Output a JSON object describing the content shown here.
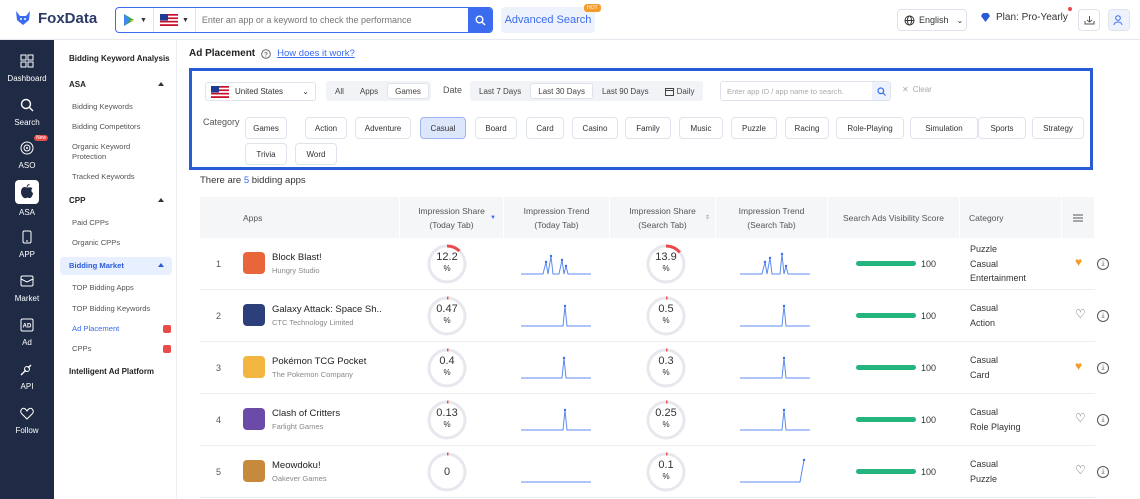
{
  "header": {
    "logo": "FoxData",
    "search_placeholder": "Enter an app or a keyword to check the performance",
    "advanced_search": "Advanced Search",
    "hot_badge": "HOT",
    "language": "English",
    "plan": "Plan: Pro-Yearly"
  },
  "sidebar": {
    "items": [
      {
        "label": "Dashboard",
        "icon": "grid-icon"
      },
      {
        "label": "Search",
        "icon": "search-icon"
      },
      {
        "label": "ASO",
        "icon": "target-icon",
        "badge": "New"
      },
      {
        "label": "ASA",
        "icon": "apple-icon"
      },
      {
        "label": "APP",
        "icon": "phone-icon"
      },
      {
        "label": "Market",
        "icon": "market-icon"
      },
      {
        "label": "Ad",
        "icon": "ad-icon"
      },
      {
        "label": "API",
        "icon": "api-icon"
      },
      {
        "label": "Follow",
        "icon": "heart-icon"
      }
    ]
  },
  "subnav": {
    "title": "Bidding Keyword Analysis",
    "asa": "ASA",
    "asa_items": [
      "Bidding Keywords",
      "Bidding Competitors",
      "Organic Keyword Protection",
      "Tracked Keywords"
    ],
    "cpp": "CPP",
    "cpp_items": [
      "Paid CPPs",
      "Organic CPPs"
    ],
    "bidding_market": "Bidding Market",
    "market_items": [
      "TOP Bidding Apps",
      "TOP Bidding Keywords",
      "Ad Placement",
      "CPPs"
    ],
    "intelligent": "Intelligent Ad Platform"
  },
  "page": {
    "title": "Ad Placement",
    "help_link": "How does it work?",
    "count_prefix": "There are ",
    "count": "5",
    "count_suffix": " bidding apps"
  },
  "filters": {
    "country": "United States",
    "type_tabs": [
      "All",
      "Apps",
      "Games"
    ],
    "type_selected": "Games",
    "date_label": "Date",
    "date_tabs": [
      "Last 7 Days",
      "Last 30 Days",
      "Last 90 Days",
      "Daily"
    ],
    "date_selected": "Last 30 Days",
    "app_search_placeholder": "Enter app ID / app name to search.",
    "clear": "Clear",
    "category_label": "Category",
    "categories": [
      "Games",
      "Action",
      "Adventure",
      "Casual",
      "Board",
      "Card",
      "Casino",
      "Family",
      "Music",
      "Puzzle",
      "Racing",
      "Role-Playing",
      "Simulation",
      "Sports",
      "Strategy",
      "Trivia",
      "Word"
    ],
    "category_selected": "Casual"
  },
  "table": {
    "headers": [
      "Apps",
      "Impression Share (Today Tab)",
      "Impression Trend (Today Tab)",
      "Impression Share (Search Tab)",
      "Impression Trend (Search Tab)",
      "Search Ads Visibility Score",
      "Category"
    ],
    "rows": [
      {
        "rank": "1",
        "name": "Block Blast!",
        "developer": "Hungry Studio",
        "today_share": "12.2",
        "today_pct": 12.2,
        "search_share": "13.9",
        "search_pct": 13.9,
        "score": "100",
        "categories": [
          "Puzzle",
          "Casual",
          "Entertainment"
        ],
        "favorite": true,
        "icon_color": "#e8663a"
      },
      {
        "rank": "2",
        "name": "Galaxy Attack: Space Sh...",
        "developer": "CTC Technology Limited",
        "today_share": "0.47",
        "today_pct": 0.47,
        "search_share": "0.5",
        "search_pct": 0.5,
        "score": "100",
        "categories": [
          "Casual",
          "Action"
        ],
        "favorite": false,
        "icon_color": "#2d3f7a"
      },
      {
        "rank": "3",
        "name": "Pokémon TCG Pocket",
        "developer": "The Pokemon Company",
        "today_share": "0.4",
        "today_pct": 0.4,
        "search_share": "0.3",
        "search_pct": 0.3,
        "score": "100",
        "categories": [
          "Casual",
          "Card"
        ],
        "favorite": true,
        "icon_color": "#f2b640"
      },
      {
        "rank": "4",
        "name": "Clash of Critters",
        "developer": "Farlight Games",
        "today_share": "0.13",
        "today_pct": 0.13,
        "search_share": "0.25",
        "search_pct": 0.25,
        "score": "100",
        "categories": [
          "Casual",
          "Role Playing"
        ],
        "favorite": false,
        "icon_color": "#6a4ba8"
      },
      {
        "rank": "5",
        "name": "Meowdoku!",
        "developer": "Oakever Games",
        "today_share": "0",
        "today_pct": 0,
        "search_share": "0.1",
        "search_pct": 0.1,
        "score": "100",
        "categories": [
          "Casual",
          "Puzzle"
        ],
        "favorite": false,
        "icon_color": "#c78a3c"
      }
    ]
  },
  "colors": {
    "accent": "#3b6cf0",
    "score_bar": "#24b47e",
    "favorite": "#f39c2b",
    "ring_marker": "#e94b4b"
  }
}
